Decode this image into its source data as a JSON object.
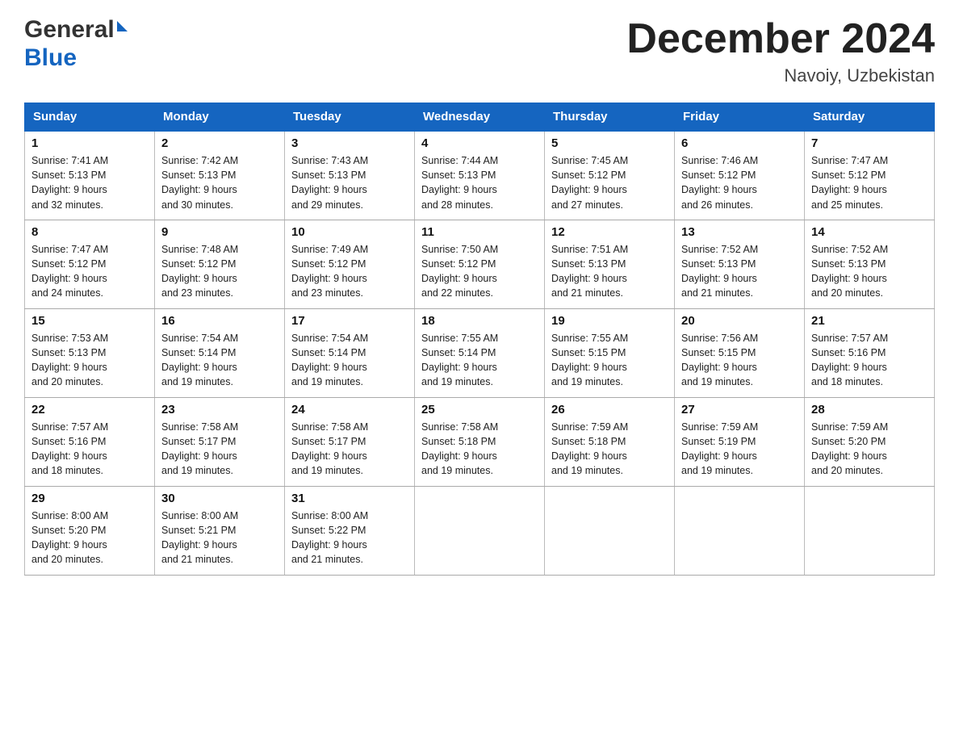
{
  "header": {
    "logo_general": "General",
    "logo_blue": "Blue",
    "month_title": "December 2024",
    "location": "Navoiy, Uzbekistan"
  },
  "days_of_week": [
    "Sunday",
    "Monday",
    "Tuesday",
    "Wednesday",
    "Thursday",
    "Friday",
    "Saturday"
  ],
  "weeks": [
    [
      {
        "num": "1",
        "sunrise": "7:41 AM",
        "sunset": "5:13 PM",
        "daylight": "9 hours and 32 minutes."
      },
      {
        "num": "2",
        "sunrise": "7:42 AM",
        "sunset": "5:13 PM",
        "daylight": "9 hours and 30 minutes."
      },
      {
        "num": "3",
        "sunrise": "7:43 AM",
        "sunset": "5:13 PM",
        "daylight": "9 hours and 29 minutes."
      },
      {
        "num": "4",
        "sunrise": "7:44 AM",
        "sunset": "5:13 PM",
        "daylight": "9 hours and 28 minutes."
      },
      {
        "num": "5",
        "sunrise": "7:45 AM",
        "sunset": "5:12 PM",
        "daylight": "9 hours and 27 minutes."
      },
      {
        "num": "6",
        "sunrise": "7:46 AM",
        "sunset": "5:12 PM",
        "daylight": "9 hours and 26 minutes."
      },
      {
        "num": "7",
        "sunrise": "7:47 AM",
        "sunset": "5:12 PM",
        "daylight": "9 hours and 25 minutes."
      }
    ],
    [
      {
        "num": "8",
        "sunrise": "7:47 AM",
        "sunset": "5:12 PM",
        "daylight": "9 hours and 24 minutes."
      },
      {
        "num": "9",
        "sunrise": "7:48 AM",
        "sunset": "5:12 PM",
        "daylight": "9 hours and 23 minutes."
      },
      {
        "num": "10",
        "sunrise": "7:49 AM",
        "sunset": "5:12 PM",
        "daylight": "9 hours and 23 minutes."
      },
      {
        "num": "11",
        "sunrise": "7:50 AM",
        "sunset": "5:12 PM",
        "daylight": "9 hours and 22 minutes."
      },
      {
        "num": "12",
        "sunrise": "7:51 AM",
        "sunset": "5:13 PM",
        "daylight": "9 hours and 21 minutes."
      },
      {
        "num": "13",
        "sunrise": "7:52 AM",
        "sunset": "5:13 PM",
        "daylight": "9 hours and 21 minutes."
      },
      {
        "num": "14",
        "sunrise": "7:52 AM",
        "sunset": "5:13 PM",
        "daylight": "9 hours and 20 minutes."
      }
    ],
    [
      {
        "num": "15",
        "sunrise": "7:53 AM",
        "sunset": "5:13 PM",
        "daylight": "9 hours and 20 minutes."
      },
      {
        "num": "16",
        "sunrise": "7:54 AM",
        "sunset": "5:14 PM",
        "daylight": "9 hours and 19 minutes."
      },
      {
        "num": "17",
        "sunrise": "7:54 AM",
        "sunset": "5:14 PM",
        "daylight": "9 hours and 19 minutes."
      },
      {
        "num": "18",
        "sunrise": "7:55 AM",
        "sunset": "5:14 PM",
        "daylight": "9 hours and 19 minutes."
      },
      {
        "num": "19",
        "sunrise": "7:55 AM",
        "sunset": "5:15 PM",
        "daylight": "9 hours and 19 minutes."
      },
      {
        "num": "20",
        "sunrise": "7:56 AM",
        "sunset": "5:15 PM",
        "daylight": "9 hours and 19 minutes."
      },
      {
        "num": "21",
        "sunrise": "7:57 AM",
        "sunset": "5:16 PM",
        "daylight": "9 hours and 18 minutes."
      }
    ],
    [
      {
        "num": "22",
        "sunrise": "7:57 AM",
        "sunset": "5:16 PM",
        "daylight": "9 hours and 18 minutes."
      },
      {
        "num": "23",
        "sunrise": "7:58 AM",
        "sunset": "5:17 PM",
        "daylight": "9 hours and 19 minutes."
      },
      {
        "num": "24",
        "sunrise": "7:58 AM",
        "sunset": "5:17 PM",
        "daylight": "9 hours and 19 minutes."
      },
      {
        "num": "25",
        "sunrise": "7:58 AM",
        "sunset": "5:18 PM",
        "daylight": "9 hours and 19 minutes."
      },
      {
        "num": "26",
        "sunrise": "7:59 AM",
        "sunset": "5:18 PM",
        "daylight": "9 hours and 19 minutes."
      },
      {
        "num": "27",
        "sunrise": "7:59 AM",
        "sunset": "5:19 PM",
        "daylight": "9 hours and 19 minutes."
      },
      {
        "num": "28",
        "sunrise": "7:59 AM",
        "sunset": "5:20 PM",
        "daylight": "9 hours and 20 minutes."
      }
    ],
    [
      {
        "num": "29",
        "sunrise": "8:00 AM",
        "sunset": "5:20 PM",
        "daylight": "9 hours and 20 minutes."
      },
      {
        "num": "30",
        "sunrise": "8:00 AM",
        "sunset": "5:21 PM",
        "daylight": "9 hours and 21 minutes."
      },
      {
        "num": "31",
        "sunrise": "8:00 AM",
        "sunset": "5:22 PM",
        "daylight": "9 hours and 21 minutes."
      },
      null,
      null,
      null,
      null
    ]
  ],
  "labels": {
    "sunrise": "Sunrise:",
    "sunset": "Sunset:",
    "daylight": "Daylight:"
  }
}
